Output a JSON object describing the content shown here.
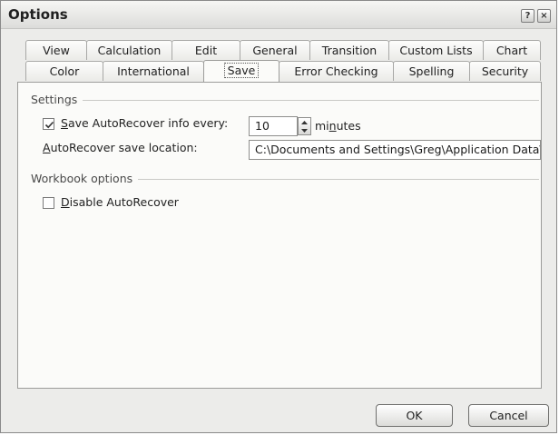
{
  "window": {
    "title": "Options",
    "help_glyph": "?",
    "close_glyph": "×"
  },
  "tabs": {
    "row_back": [
      {
        "label": "View"
      },
      {
        "label": "Calculation"
      },
      {
        "label": "Edit"
      },
      {
        "label": "General"
      },
      {
        "label": "Transition"
      },
      {
        "label": "Custom Lists"
      },
      {
        "label": "Chart"
      }
    ],
    "row_front": [
      {
        "label": "Color"
      },
      {
        "label": "International"
      },
      {
        "label": "Save",
        "active": true
      },
      {
        "label": "Error Checking"
      },
      {
        "label": "Spelling"
      },
      {
        "label": "Security"
      }
    ]
  },
  "settings": {
    "section_label": "Settings",
    "autorecover": {
      "checked": true,
      "label_accel": "S",
      "label_rest": "ave AutoRecover info every:",
      "interval_value": "10",
      "units_pre": "mi",
      "units_accel": "n",
      "units_post": "utes"
    },
    "location": {
      "label_accel": "A",
      "label_rest": "utoRecover save location:",
      "value": "C:\\Documents and Settings\\Greg\\Application Data\\Microsoft\\Excel\\"
    }
  },
  "workbook_options": {
    "section_label": "Workbook options",
    "disable_autorecover": {
      "checked": false,
      "label_accel": "D",
      "label_rest": "isable AutoRecover"
    }
  },
  "buttons": {
    "ok_label": "OK",
    "cancel_label": "Cancel"
  },
  "colors": {
    "dialog_bg": "#ececea",
    "panel_bg": "#fbfbf9",
    "border": "#9c9c9a"
  },
  "icons": {
    "help": "help-icon",
    "close": "close-icon",
    "check": "checkmark-icon",
    "spin_up": "arrow-up-icon",
    "spin_down": "arrow-down-icon"
  }
}
